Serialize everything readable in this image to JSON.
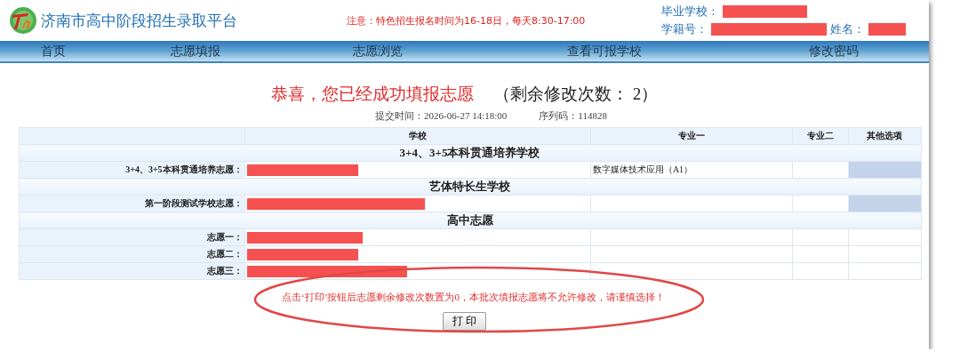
{
  "header": {
    "title": "济南市高中阶段招生录取平台",
    "notice": "注意：特色招生报名时间为16-18日，每天8:30-17:00",
    "student_lines": [
      [
        {
          "label": "毕业学校：",
          "redacted": true
        }
      ],
      [
        {
          "label": "学籍号：",
          "redacted": true
        },
        {
          "label": "姓名：",
          "redacted": true
        }
      ]
    ]
  },
  "nav": {
    "items": [
      "首页",
      "志愿填报",
      "志愿浏览",
      "查看可报学校",
      "修改密码"
    ]
  },
  "result": {
    "heading": "恭喜，您已经成功填报志愿",
    "remaining": "（剩余修改次数： 2）",
    "submit_time": "提交时间：2026-06-27 14:18:00",
    "serial": "序列码：114828",
    "table": {
      "columns": [
        "学校",
        "专业一",
        "专业二",
        "其他选项"
      ],
      "rows": [
        {
          "kind": "group",
          "title": "3+4、3+5本科贯通培养学校"
        },
        {
          "kind": "choice",
          "label": "3+4、3+5本科贯通培养志愿：",
          "school_redacted": true,
          "major_1": "数字媒体技术应用（A1）",
          "other_disabled": true
        },
        {
          "kind": "group",
          "title": "艺体特长生学校"
        },
        {
          "kind": "choice",
          "label": "第一阶段测试学校志愿：",
          "school_redacted": true,
          "other_disabled": true
        },
        {
          "kind": "group",
          "title": "高中志愿"
        },
        {
          "kind": "choice",
          "label": "志愿一：",
          "school_redacted": true,
          "other_disabled": false
        },
        {
          "kind": "choice",
          "label": "志愿二：",
          "school_redacted": true,
          "other_disabled": false
        },
        {
          "kind": "choice",
          "label": "志愿三：",
          "school_redacted": true,
          "other_disabled": false
        }
      ]
    },
    "warning": "点击‘打印’按钮后志愿剩余修改次数置为0，本批次填报志愿将不允许修改，请谨慎选择！",
    "print_button": "打 印",
    "annotation_circled": true
  }
}
